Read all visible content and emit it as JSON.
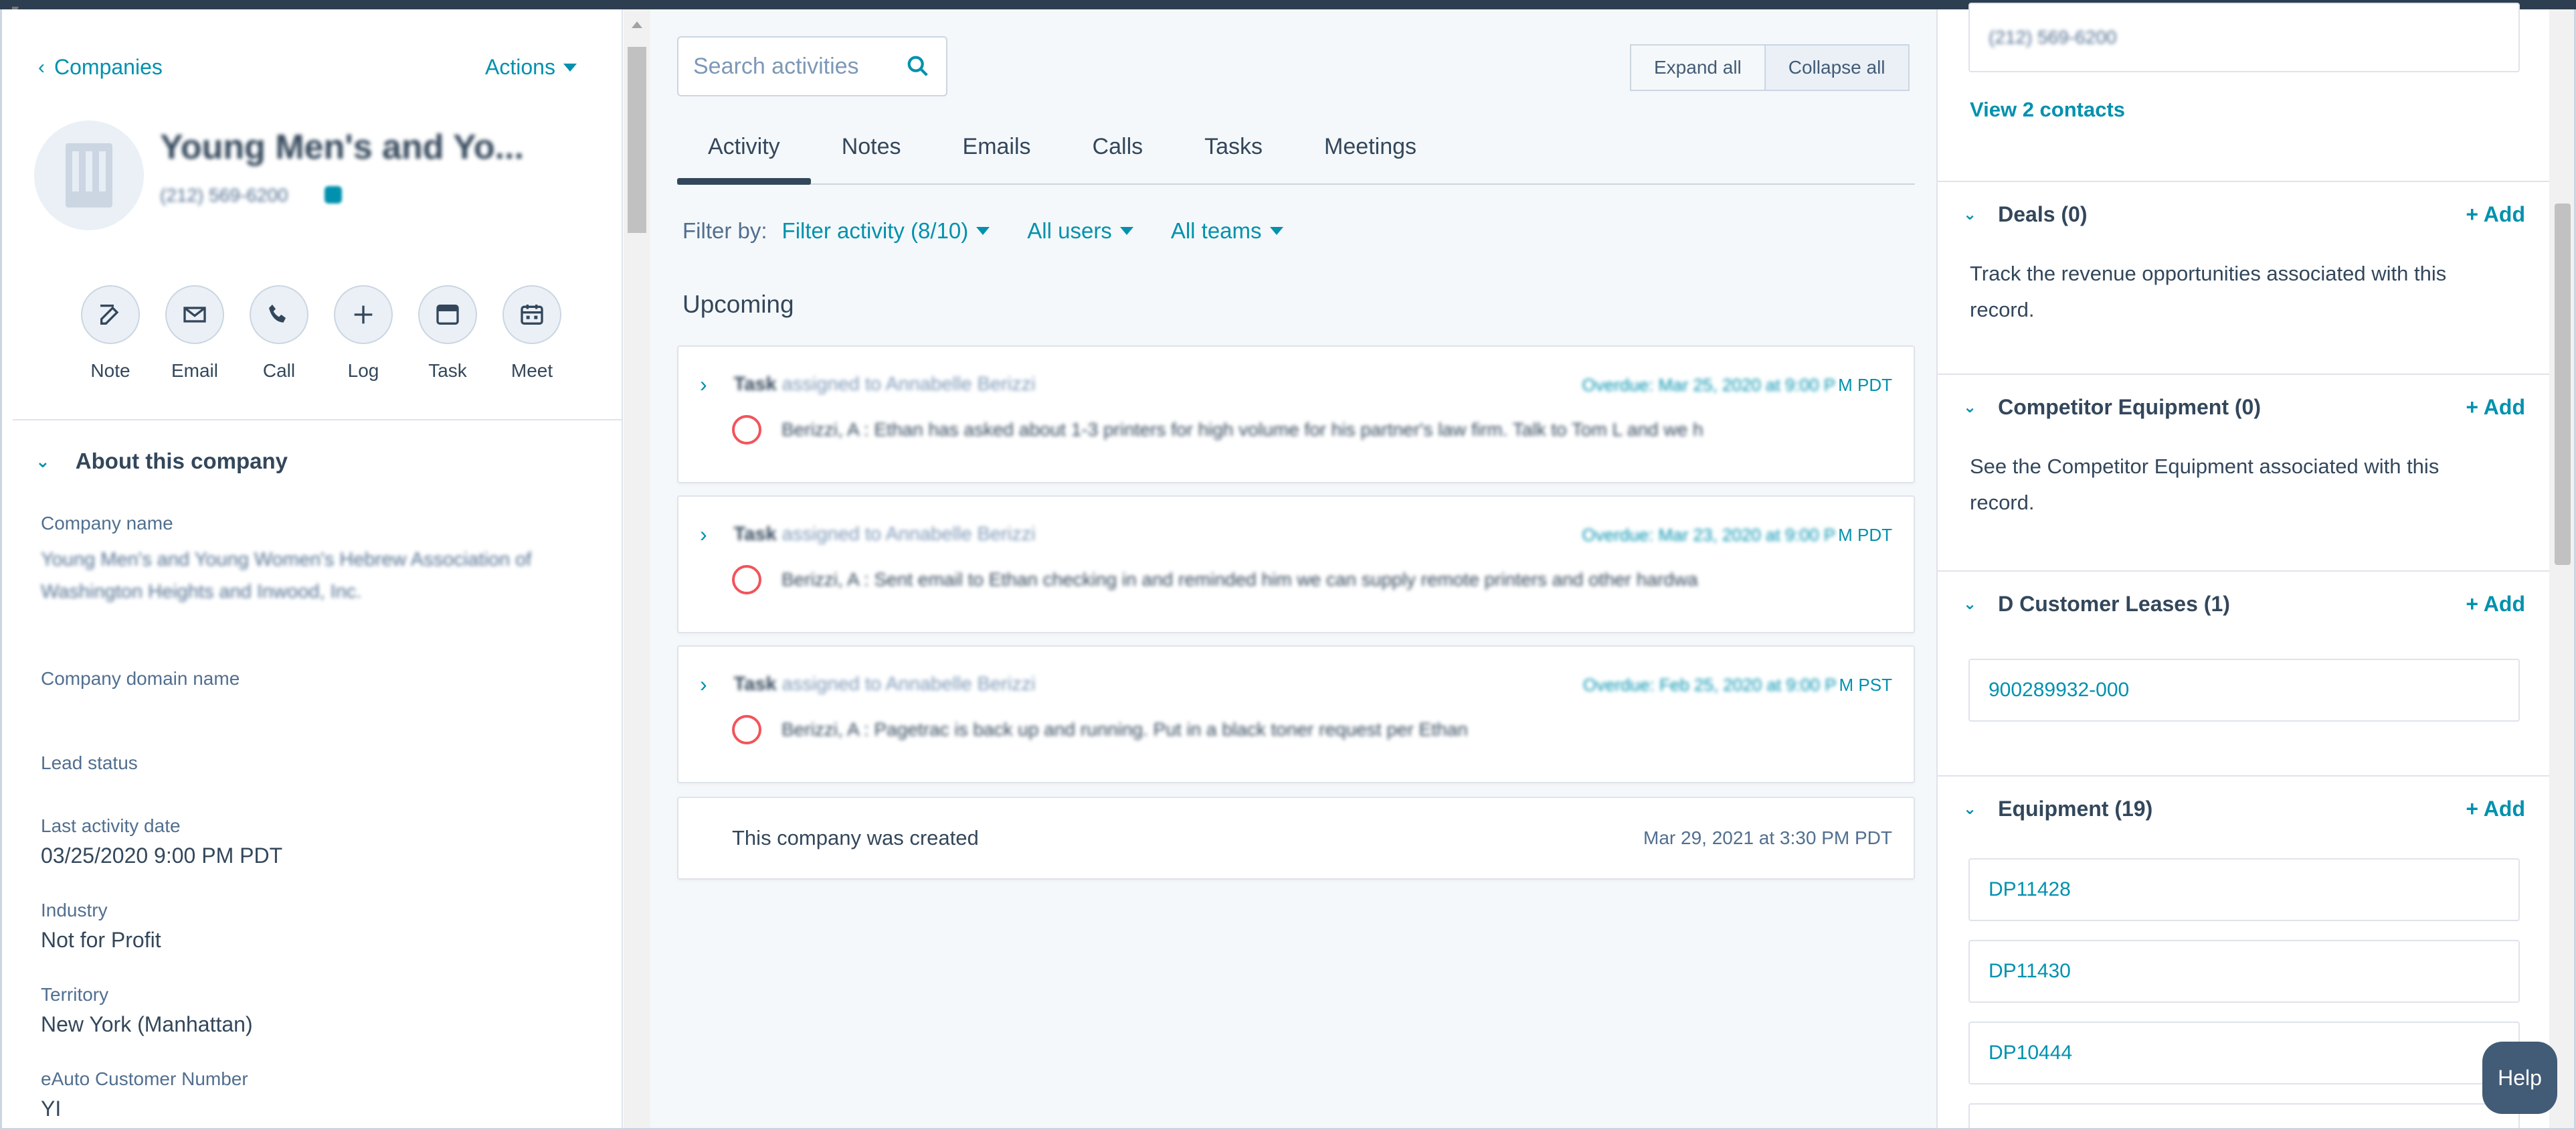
{
  "left": {
    "back_label": "Companies",
    "actions_label": "Actions",
    "company_title": "Young Men's and Yo...",
    "company_phone": "(212) 569-6200",
    "quick_actions": [
      {
        "label": "Note",
        "icon": "note-icon"
      },
      {
        "label": "Email",
        "icon": "email-icon"
      },
      {
        "label": "Call",
        "icon": "call-icon"
      },
      {
        "label": "Log",
        "icon": "plus-icon"
      },
      {
        "label": "Task",
        "icon": "task-icon"
      },
      {
        "label": "Meet",
        "icon": "calendar-icon"
      }
    ],
    "about_title": "About this company",
    "properties": {
      "company_name_label": "Company name",
      "company_name_value": "Young Men's and Young Women's Hebrew Association of Washington Heights and Inwood, Inc.",
      "domain_label": "Company domain name",
      "lead_status_label": "Lead status",
      "last_activity_label": "Last activity date",
      "last_activity_value": "03/25/2020 9:00 PM PDT",
      "industry_label": "Industry",
      "industry_value": "Not for Profit",
      "territory_label": "Territory",
      "territory_value": "New York (Manhattan)",
      "eauto_label": "eAuto Customer Number",
      "eauto_value": "YI"
    }
  },
  "middle": {
    "search_placeholder": "Search activities",
    "expand_all": "Expand all",
    "collapse_all": "Collapse all",
    "tabs": [
      "Activity",
      "Notes",
      "Emails",
      "Calls",
      "Tasks",
      "Meetings"
    ],
    "filter_by": "Filter by:",
    "filter_activity": "Filter activity (8/10)",
    "all_users": "All users",
    "all_teams": "All teams",
    "upcoming": "Upcoming",
    "tasks": [
      {
        "type": "Task",
        "assigned": "assigned to Annabelle Berizzi",
        "due": "Overdue: Mar 25, 2020 at 9:00 P",
        "tz": "M PDT",
        "body": "Berizzi, A : Ethan has asked about 1-3 printers for high volume for his partner's law firm. Talk to Tom L and we h"
      },
      {
        "type": "Task",
        "assigned": "assigned to Annabelle Berizzi",
        "due": "Overdue: Mar 23, 2020 at 9:00 P",
        "tz": "M PDT",
        "body": "Berizzi, A : Sent email to Ethan checking in and reminded him we can supply remote printers and other hardwa"
      },
      {
        "type": "Task",
        "assigned": "assigned to Annabelle Berizzi",
        "due": "Overdue: Feb 25, 2020 at 9:00 P",
        "tz": "M PST",
        "body": "Berizzi, A : Pagetrac is back up and running. Put in a black toner request per Ethan"
      }
    ],
    "created_text": "This company was created",
    "created_date": "Mar 29, 2021 at 3:30 PM PDT"
  },
  "right": {
    "top_phone": "(212) 569-6200",
    "view_contacts": "View 2 contacts",
    "add_label": "+ Add",
    "deals_title": "Deals (0)",
    "deals_desc": "Track the revenue opportunities associated with this record.",
    "competitor_title": "Competitor Equipment (0)",
    "competitor_desc": "See the Competitor Equipment associated with this record.",
    "leases_title": "D Customer Leases (1)",
    "lease_record": "900289932-000",
    "equipment_title": "Equipment (19)",
    "equipment_records": [
      "DP11428",
      "DP11430",
      "DP10444"
    ],
    "help_label": "Help"
  }
}
